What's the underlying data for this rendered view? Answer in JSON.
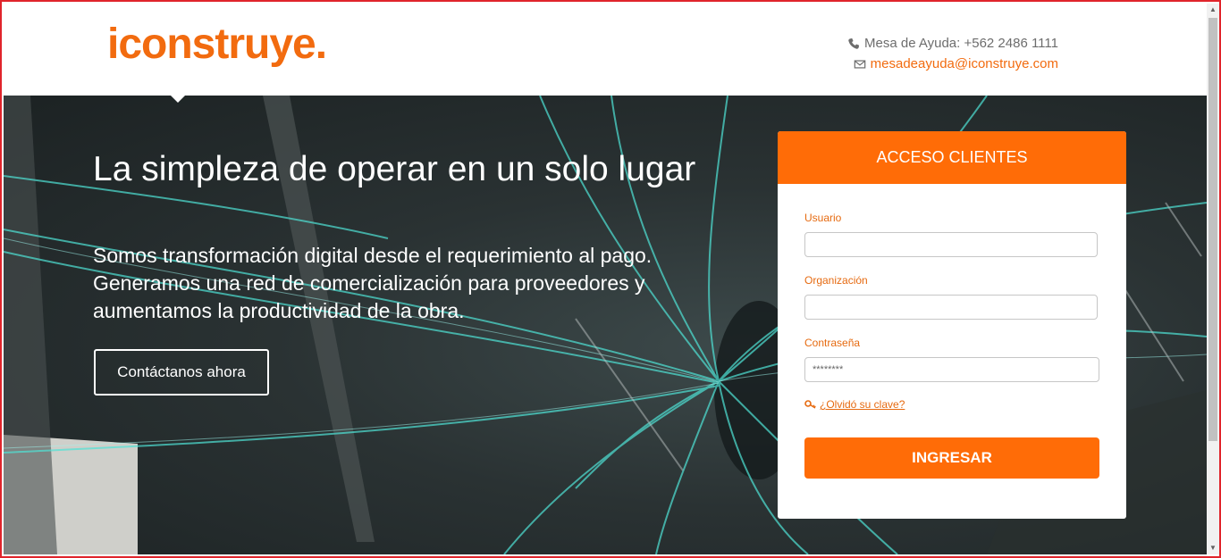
{
  "brand": {
    "logo_text": "iconstruye",
    "logo_dot": ".",
    "color": "#f26b0f"
  },
  "header": {
    "phone": "Mesa de Ayuda: +562 2486 1111",
    "email": "mesadeayuda@iconstruye.com"
  },
  "hero": {
    "headline": "La simpleza de operar en un solo lugar",
    "subtext": "Somos transformación digital desde el requerimiento al pago. Generamos una red de comercialización para proveedores y aumentamos la productividad de la obra.",
    "cta_label": "Contáctanos ahora"
  },
  "login": {
    "title": "ACCESO CLIENTES",
    "user_label": "Usuario",
    "user_value": "",
    "org_label": "Organización",
    "org_value": "",
    "password_label": "Contraseña",
    "password_value": "********",
    "forgot_label": "¿Olvidó su clave?",
    "submit_label": "INGRESAR",
    "accent": "#ff6c07"
  }
}
